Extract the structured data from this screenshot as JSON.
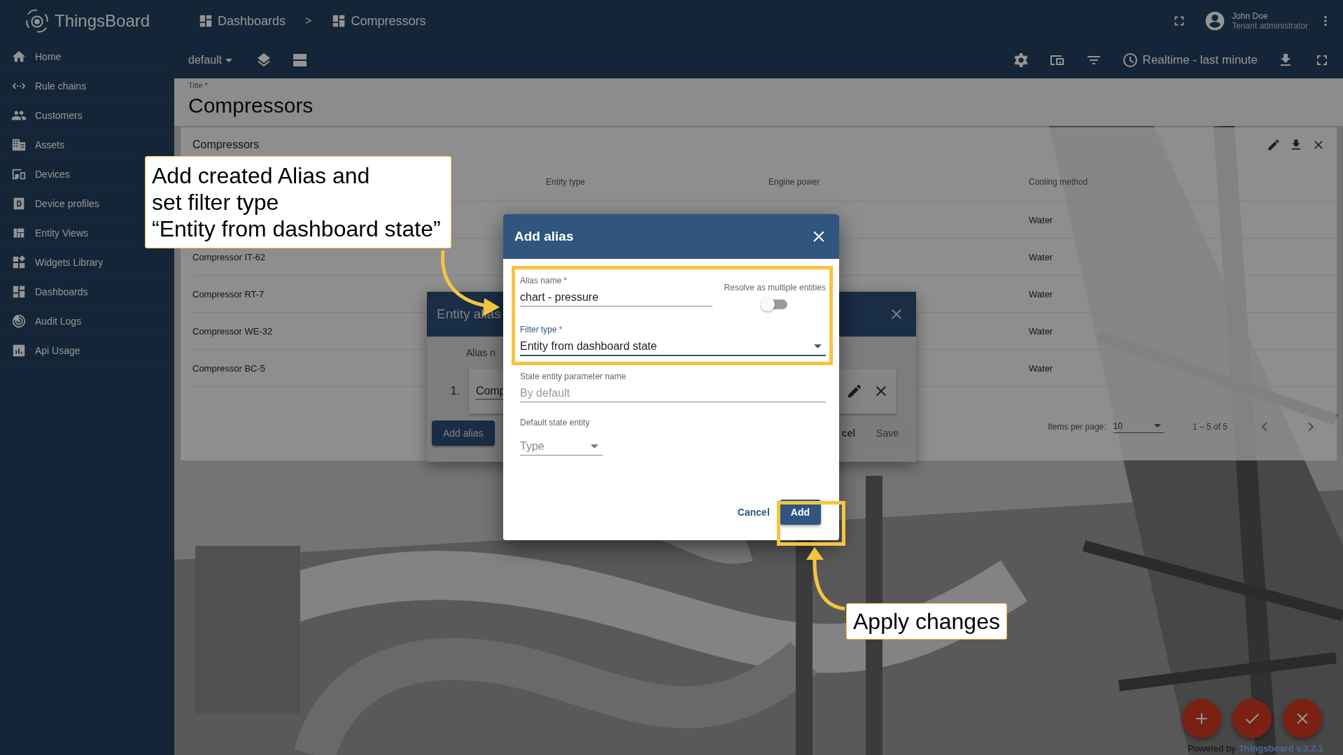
{
  "app": {
    "logo": "ThingsBoard"
  },
  "sidebar": {
    "items": [
      {
        "label": "Home"
      },
      {
        "label": "Rule chains"
      },
      {
        "label": "Customers"
      },
      {
        "label": "Assets"
      },
      {
        "label": "Devices"
      },
      {
        "label": "Device profiles"
      },
      {
        "label": "Entity Views"
      },
      {
        "label": "Widgets Library"
      },
      {
        "label": "Dashboards"
      },
      {
        "label": "Audit Logs"
      },
      {
        "label": "Api Usage"
      }
    ]
  },
  "breadcrumb": {
    "items": [
      "Dashboards",
      "Compressors"
    ],
    "separator": ">"
  },
  "user": {
    "name": "John Doe",
    "role": "Tenant administrator"
  },
  "toolbar": {
    "state": "default",
    "timewindow": "Realtime - last minute"
  },
  "title_field": {
    "label": "Title *",
    "value": "Compressors"
  },
  "widget": {
    "title": "Compressors",
    "columns": [
      "Entity type",
      "Engine power",
      "Cooling method"
    ],
    "rows": [
      {
        "cooling_method": "Water"
      },
      {
        "name": "Compressor IT-62",
        "cooling_method": "Water"
      },
      {
        "name": "Compressor RT-7",
        "cooling_method": "Water"
      },
      {
        "name": "Compressor WE-32",
        "cooling_method": "Water"
      },
      {
        "name": "Compressor BC-5",
        "cooling_method": "Water"
      }
    ],
    "paginator": {
      "label": "Items per page:",
      "page_size": "10",
      "range": "1 – 5 of 5"
    }
  },
  "entity_aliases_dialog": {
    "title": "Entity alias",
    "column": "Alias n",
    "rows": [
      {
        "number": "1.",
        "alias": "Comp"
      }
    ],
    "buttons": [
      {
        "label": "Add alias",
        "kind": "primary",
        "disabled": false
      },
      {
        "label": "cel",
        "kind": "text",
        "disabled": false
      },
      {
        "label": "Save",
        "kind": "primary",
        "disabled": true
      }
    ]
  },
  "add_alias_dialog": {
    "title": "Add alias",
    "alias_name": {
      "label": "Alias name",
      "required_mark": "*",
      "value": "chart - pressure"
    },
    "resolve_multiple": {
      "label": "Resolve as multiple entities",
      "on": false
    },
    "filter_type": {
      "label": "Filter type",
      "required_mark": "*",
      "value": "Entity from dashboard state",
      "focused": true
    },
    "state_param": {
      "label": "State entity parameter name",
      "placeholder": "By default"
    },
    "default_state_entity": {
      "label": "Default state entity",
      "placeholder": "Type"
    },
    "buttons": [
      {
        "label": "Cancel",
        "kind": "text"
      },
      {
        "label": "Add",
        "kind": "primary"
      }
    ]
  },
  "callouts": [
    {
      "lines": [
        "Add created Alias and",
        "set filter type",
        "“Entity from dashboard state”"
      ]
    },
    {
      "lines": [
        "Apply changes"
      ]
    }
  ],
  "footer": {
    "prefix": "Powered by",
    "link": "Thingsboard v.3.2.1"
  }
}
